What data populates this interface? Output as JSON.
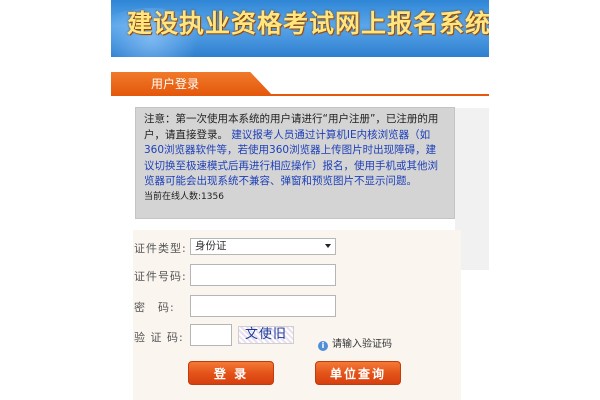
{
  "header": {
    "title": "建设执业资格考试网上报名系统"
  },
  "login_tab": {
    "label": "用户登录"
  },
  "notice": {
    "line1": "注意：第一次使用本系统的用户请进行“用户注册”，已注册的用户，请直接登录。",
    "line2": "建议报考人员通过计算机IE内核浏览器（如360浏览器软件等，若使用360浏览器上传图片时出现障碍，建议切换至极速模式后再进行相应操作）报名，使用手机或其他浏览器可能会出现系统不兼容、弹窗和预览图片不显示问题。",
    "online_label": "当前在线人数:",
    "online_count": "1356"
  },
  "form": {
    "id_type_label": "证件类型:",
    "id_type_value": "身份证",
    "id_number_label": "证件号码:",
    "password_label": "密　码:",
    "captcha_label": "验 证 码:",
    "captcha_text": "文使旧",
    "captcha_hint": "请输入验证码"
  },
  "buttons": {
    "login": "登 录",
    "unit_query": "单位查询"
  },
  "colors": {
    "accent": "#e4570b",
    "banner": "#2f86d6",
    "notice_link": "#1d3fb8"
  }
}
